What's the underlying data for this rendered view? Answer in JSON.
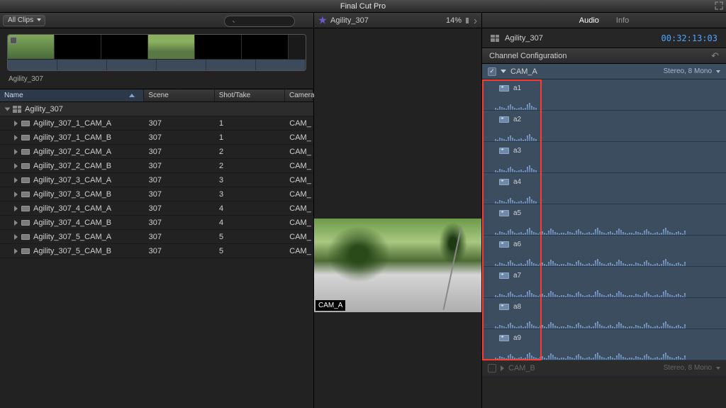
{
  "app_title": "Final Cut Pro",
  "toolbar": {
    "left": {
      "filter_label": "All Clips",
      "search_placeholder": ""
    },
    "middle": {
      "title": "Agility_307",
      "zoom": "14%"
    },
    "right": {
      "tabs": [
        "Audio",
        "Info"
      ],
      "active_tab": 0
    }
  },
  "inspector": {
    "clip_name": "Agility_307",
    "timecode": "00:32:13:03",
    "section_title": "Channel Configuration",
    "cams": [
      {
        "name": "CAM_A",
        "expanded": true,
        "enabled": true,
        "format": "Stereo, 8 Mono",
        "channels": [
          "a1",
          "a2",
          "a3",
          "a4",
          "a5",
          "a6",
          "a7",
          "a8",
          "a9"
        ]
      },
      {
        "name": "CAM_B",
        "expanded": false,
        "enabled": false,
        "format": "Stereo, 8 Mono",
        "channels": []
      }
    ]
  },
  "browser": {
    "filmstrip_label": "Agility_307",
    "columns": {
      "name": "Name",
      "scene": "Scene",
      "shot": "Shot/Take",
      "camera": "Camera"
    },
    "group_row": "Agility_307",
    "rows": [
      {
        "name": "Agility_307_1_CAM_A",
        "scene": "307",
        "shot": "1",
        "camera": "CAM_"
      },
      {
        "name": "Agility_307_1_CAM_B",
        "scene": "307",
        "shot": "1",
        "camera": "CAM_"
      },
      {
        "name": "Agility_307_2_CAM_A",
        "scene": "307",
        "shot": "2",
        "camera": "CAM_"
      },
      {
        "name": "Agility_307_2_CAM_B",
        "scene": "307",
        "shot": "2",
        "camera": "CAM_"
      },
      {
        "name": "Agility_307_3_CAM_A",
        "scene": "307",
        "shot": "3",
        "camera": "CAM_"
      },
      {
        "name": "Agility_307_3_CAM_B",
        "scene": "307",
        "shot": "3",
        "camera": "CAM_"
      },
      {
        "name": "Agility_307_4_CAM_A",
        "scene": "307",
        "shot": "4",
        "camera": "CAM_"
      },
      {
        "name": "Agility_307_4_CAM_B",
        "scene": "307",
        "shot": "4",
        "camera": "CAM_"
      },
      {
        "name": "Agility_307_5_CAM_A",
        "scene": "307",
        "shot": "5",
        "camera": "CAM_"
      },
      {
        "name": "Agility_307_5_CAM_B",
        "scene": "307",
        "shot": "5",
        "camera": "CAM_"
      }
    ]
  },
  "viewer": {
    "angle_label": "CAM_A"
  }
}
